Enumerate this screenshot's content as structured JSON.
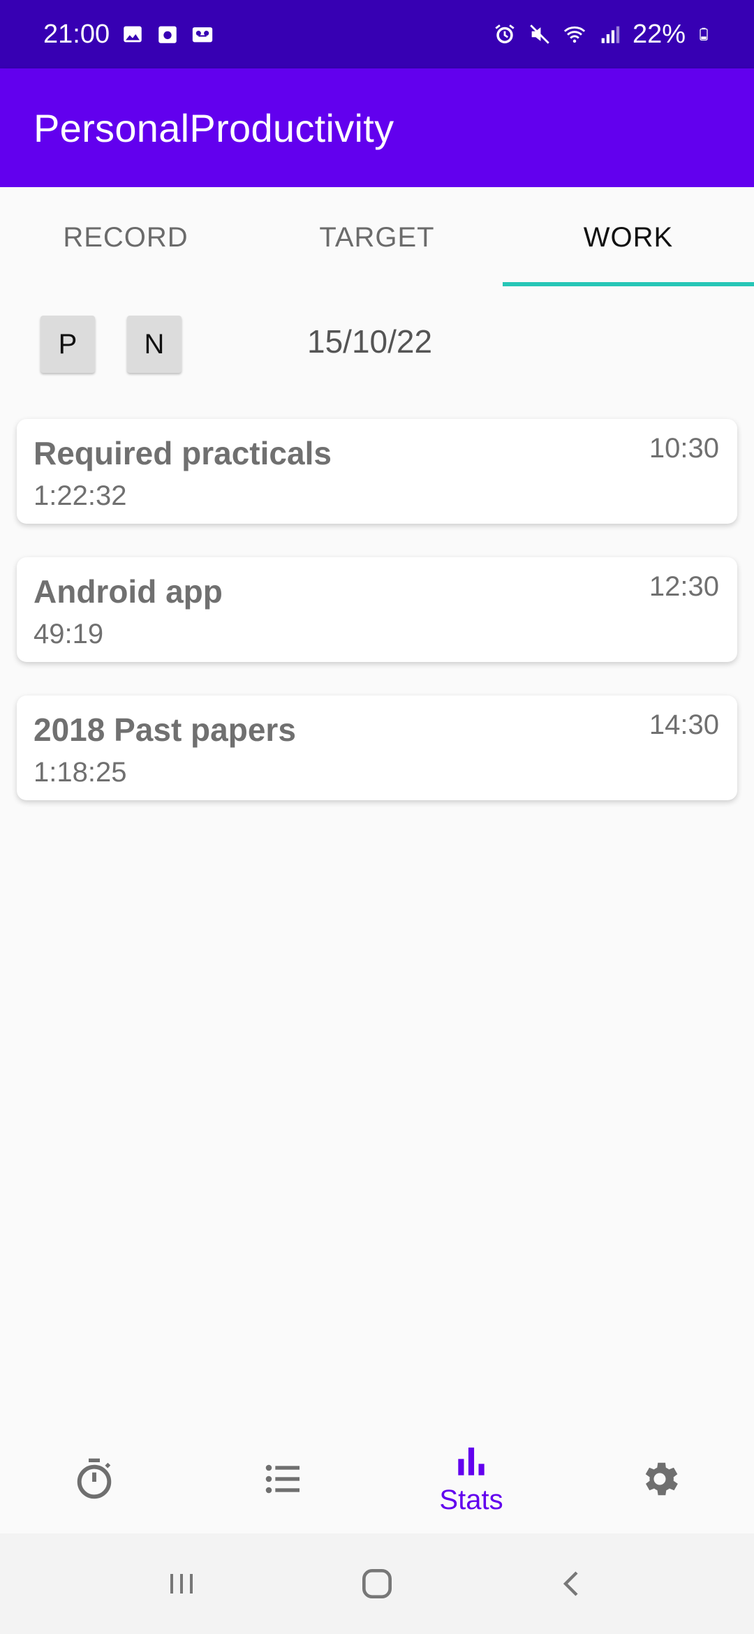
{
  "status_bar": {
    "time": "21:00",
    "battery": "22%",
    "left_icons": [
      "image-icon",
      "calendar-icon",
      "voicemail-icon"
    ],
    "right_icons": [
      "alarm-icon",
      "mute-icon",
      "wifi-icon",
      "signal-icon",
      "battery-icon"
    ]
  },
  "app_bar": {
    "title": "PersonalProductivity",
    "color": "#6200ee"
  },
  "tabs": [
    {
      "label": "RECORD",
      "active": false
    },
    {
      "label": "TARGET",
      "active": false
    },
    {
      "label": "WORK",
      "active": true
    }
  ],
  "navigation": {
    "prev_label": "P",
    "next_label": "N",
    "date": "15/10/22"
  },
  "work_items": [
    {
      "title": "Required practicals",
      "duration": "1:22:32",
      "time": "10:30"
    },
    {
      "title": "Android app",
      "duration": "49:19",
      "time": "12:30"
    },
    {
      "title": "2018 Past papers",
      "duration": "1:18:25",
      "time": "14:30"
    }
  ],
  "bottom_nav": {
    "items": [
      {
        "icon": "timer-icon",
        "label": ""
      },
      {
        "icon": "list-icon",
        "label": ""
      },
      {
        "icon": "bar-chart-icon",
        "label": "Stats",
        "active": true
      },
      {
        "icon": "gear-icon",
        "label": ""
      }
    ]
  },
  "colors": {
    "status_bar": "#3700b3",
    "primary": "#6200ee",
    "tab_indicator": "#26c6b6"
  }
}
